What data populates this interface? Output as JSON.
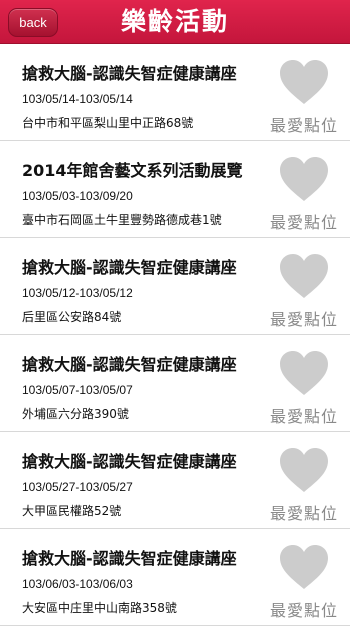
{
  "header": {
    "title": "樂齡活動",
    "back_label": "back"
  },
  "favorite_label": "最愛點位",
  "icons": {
    "favorite": "heart-icon"
  },
  "colors": {
    "header": "#d11f45",
    "heart": "#cccccc",
    "favorite_text": "#8a8a8a"
  },
  "events": [
    {
      "title": "搶救大腦-認識失智症健康講座",
      "date": "103/05/14-103/05/14",
      "address": "台中市和平區梨山里中正路68號"
    },
    {
      "title": "2014年館舍藝文系列活動展覽",
      "date": "103/05/03-103/09/20",
      "address": "臺中市石岡區土牛里豐勢路德成巷1號"
    },
    {
      "title": "搶救大腦-認識失智症健康講座",
      "date": "103/05/12-103/05/12",
      "address": "后里區公安路84號"
    },
    {
      "title": "搶救大腦-認識失智症健康講座",
      "date": "103/05/07-103/05/07",
      "address": "外埔區六分路390號"
    },
    {
      "title": "搶救大腦-認識失智症健康講座",
      "date": "103/05/27-103/05/27",
      "address": "大甲區民權路52號"
    },
    {
      "title": "搶救大腦-認識失智症健康講座",
      "date": "103/06/03-103/06/03",
      "address": "大安區中庄里中山南路358號"
    }
  ]
}
